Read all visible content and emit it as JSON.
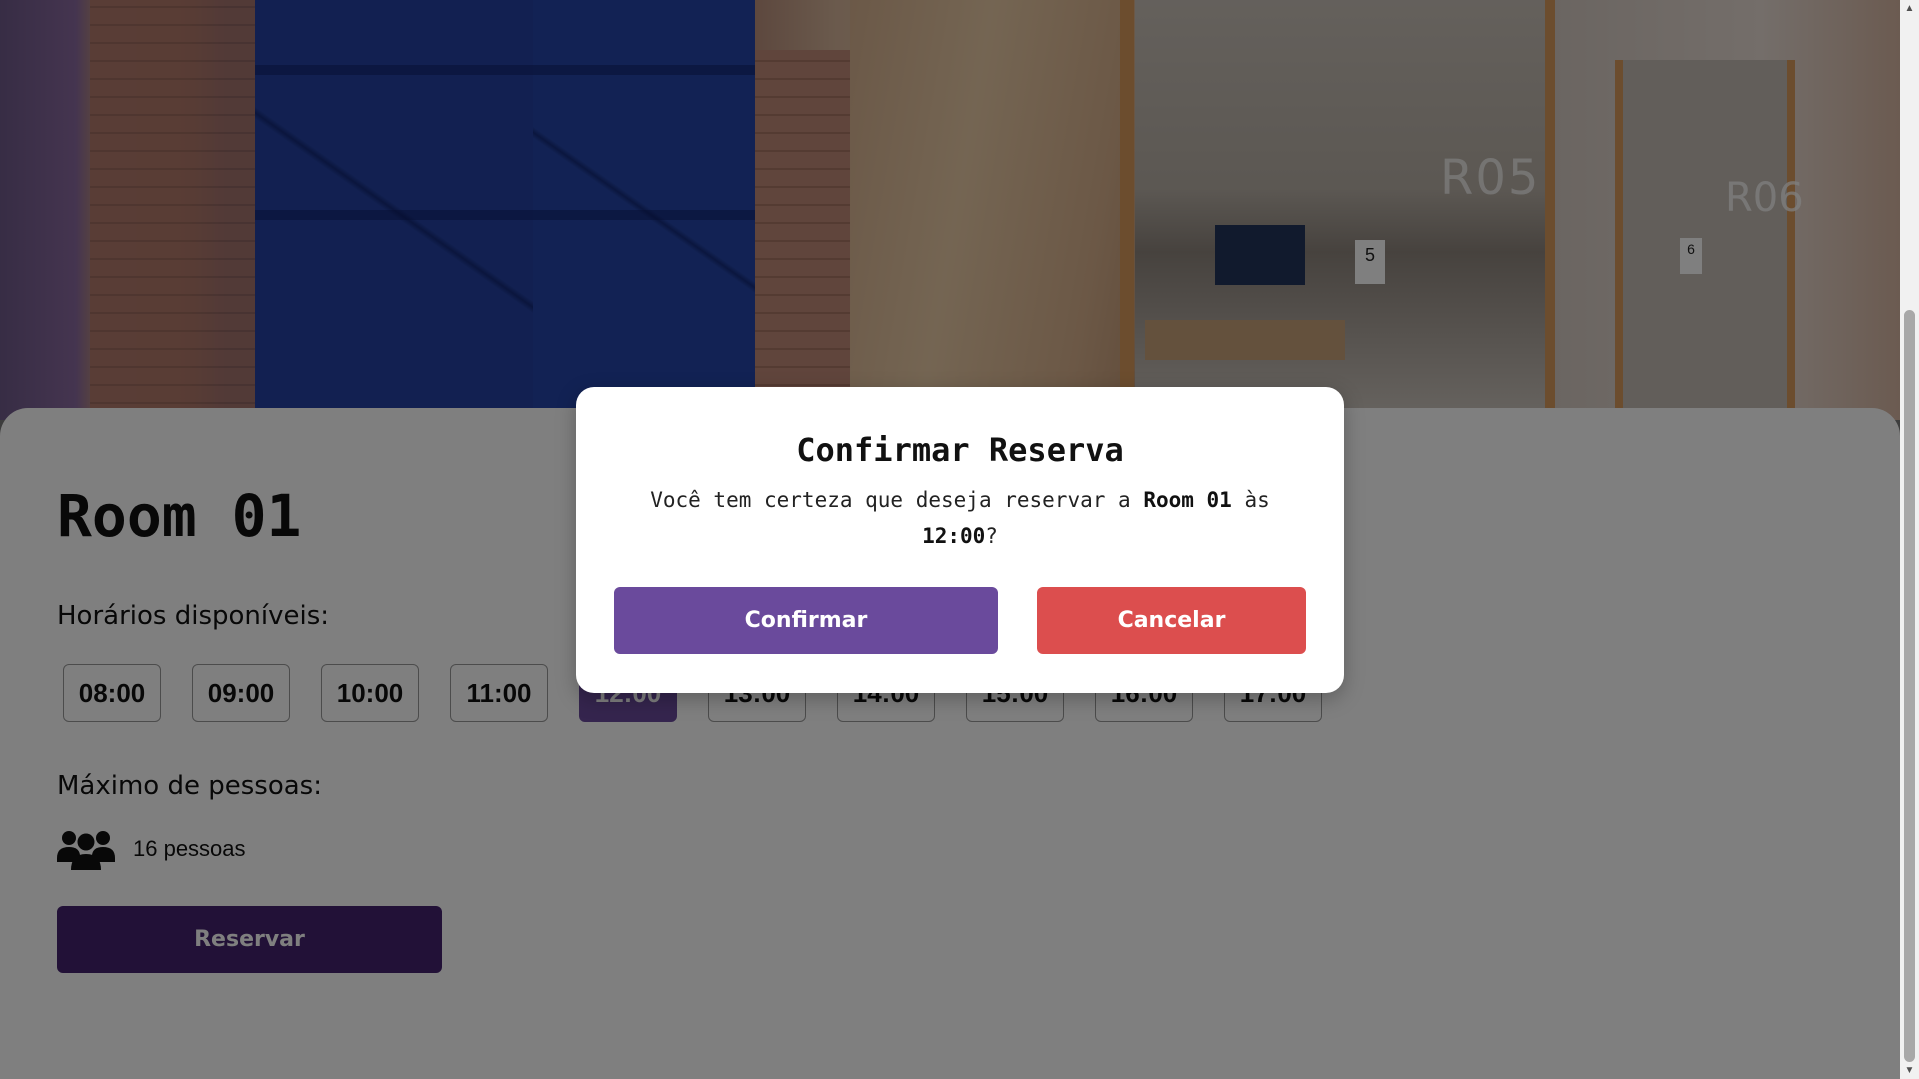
{
  "room": {
    "title": "Room 01",
    "slots_label": "Horários disponíveis:",
    "slots": [
      "08:00",
      "09:00",
      "10:00",
      "11:00",
      "12:00",
      "13:00",
      "14:00",
      "15:00",
      "16:00",
      "17:00"
    ],
    "selected_slot": "12:00",
    "capacity_label": "Máximo de pessoas:",
    "capacity_text": "16 pessoas",
    "capacity_icon": "users-icon",
    "reserve_button": "Reservar"
  },
  "hero": {
    "room_labels": [
      "R05",
      "R06"
    ],
    "numbers": [
      "5",
      "6"
    ]
  },
  "modal": {
    "title": "Confirmar Reserva",
    "message_prefix": "Você tem certeza que deseja reservar a ",
    "room_name": "Room 01",
    "message_middle": " às ",
    "time": "12:00",
    "message_suffix": "?",
    "confirm_label": "Confirmar",
    "cancel_label": "Cancelar"
  },
  "colors": {
    "accent": "#6a4a9c",
    "reserve_button": "#45226f",
    "cancel": "#dc4e4e",
    "overlay": "rgba(0,0,0,0.5)"
  }
}
